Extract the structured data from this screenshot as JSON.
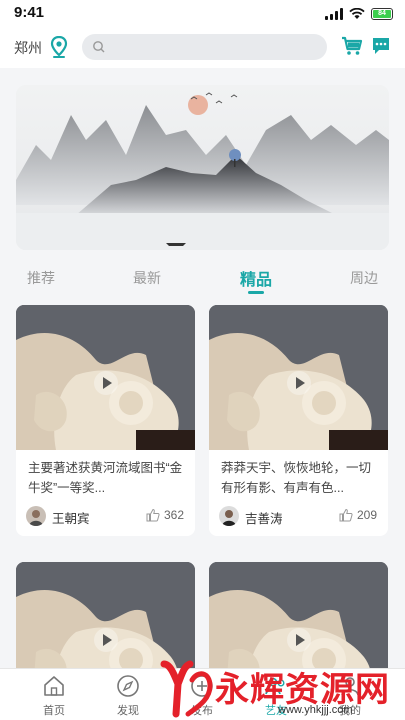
{
  "status_bar": {
    "time": "9:41",
    "battery": "84"
  },
  "header": {
    "city": "郑州",
    "search_placeholder": "",
    "icons": [
      "location-pin-icon",
      "search-icon",
      "cart-icon",
      "message-icon"
    ]
  },
  "colors": {
    "accent": "#1aa7a7",
    "watermark": "#e4212a"
  },
  "tabs": [
    {
      "label": "推荐",
      "active": false
    },
    {
      "label": "最新",
      "active": false
    },
    {
      "label": "精品",
      "active": true
    },
    {
      "label": "周边",
      "active": false
    }
  ],
  "cards": [
    {
      "title": "主要著述获黄河流域图书“金牛奖”一等奖...",
      "author": "王朝宾",
      "likes": "362"
    },
    {
      "title": "莽莽天宇、恢恢地轮，一切有形有影、有声有色...",
      "author": "吉善涛",
      "likes": "209"
    },
    {
      "title": "",
      "author": "",
      "likes": ""
    },
    {
      "title": "",
      "author": "",
      "likes": ""
    }
  ],
  "bottom_nav": [
    {
      "label": "首页",
      "icon": "home-icon"
    },
    {
      "label": "发现",
      "icon": "compass-icon"
    },
    {
      "label": "发布",
      "icon": "publish-icon"
    },
    {
      "label": "艺友",
      "icon": "friends-icon"
    },
    {
      "label": "我的",
      "icon": "profile-icon"
    }
  ],
  "watermark": {
    "text": "永辉资源网",
    "url": "www.yhkjjj.com"
  }
}
